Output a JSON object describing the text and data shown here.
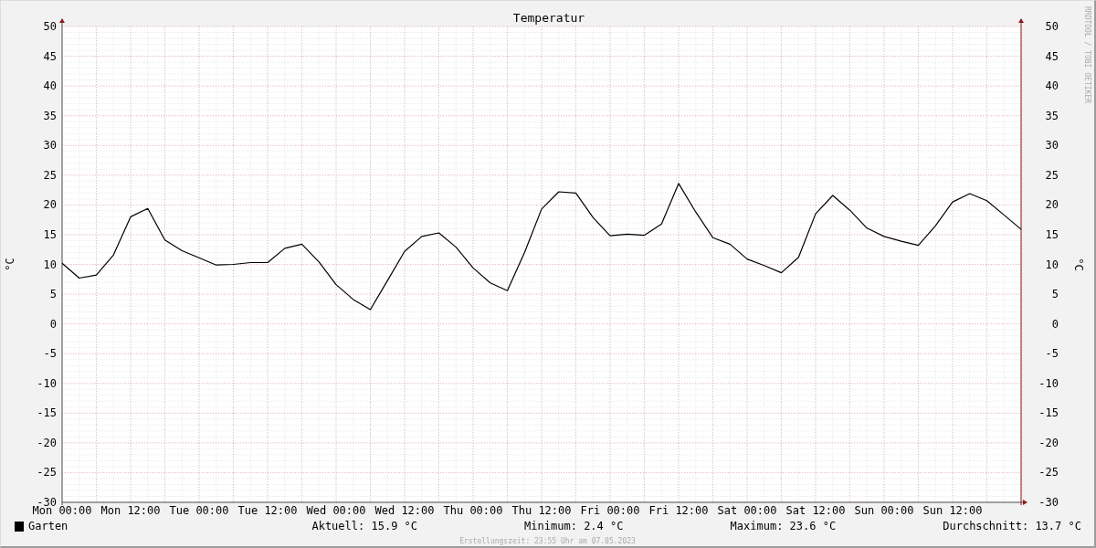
{
  "chart": {
    "credit": "RRDTOOL / TOBI OETIKER",
    "right_axis": {
      "label": "°C",
      "ticks": [
        "50",
        "45",
        "40",
        "35",
        "30",
        "25",
        "20",
        "15",
        "10",
        "5",
        "0",
        "-5",
        "-10",
        "-15",
        "-20",
        "-25",
        "-30"
      ]
    },
    "chart_data": {
      "type": "line",
      "title": "Temperatur",
      "ylabel": "°C",
      "categories": [
        "Mon 00:00",
        null,
        null,
        null,
        "Mon 12:00",
        null,
        null,
        null,
        "Tue 00:00",
        null,
        null,
        null,
        "Tue 12:00",
        null,
        null,
        null,
        "Wed 00:00",
        null,
        null,
        null,
        "Wed 12:00",
        null,
        null,
        null,
        "Thu 00:00",
        null,
        null,
        null,
        "Thu 12:00",
        null,
        null,
        null,
        "Fri 00:00",
        null,
        null,
        null,
        "Fri 12:00",
        null,
        null,
        null,
        "Sat 00:00",
        null,
        null,
        null,
        "Sat 12:00",
        null,
        null,
        null,
        "Sun 00:00",
        null,
        null,
        null,
        "Sun 12:00",
        null,
        null,
        null,
        null
      ],
      "series": [
        {
          "name": "Garten",
          "color": "#000000",
          "values": [
            10.2,
            7.7,
            8.2,
            11.6,
            18,
            19.4,
            14.1,
            12.3,
            11.1,
            9.9,
            10,
            10.3,
            10.3,
            12.7,
            13.4,
            10.4,
            6.6,
            4.1,
            2.4,
            7.3,
            12.2,
            14.7,
            15.3,
            12.9,
            9.4,
            6.9,
            5.6,
            12,
            19.3,
            22.2,
            22,
            17.9,
            14.8,
            15.1,
            14.9,
            16.8,
            23.6,
            18.8,
            14.5,
            13.4,
            10.9,
            9.8,
            8.6,
            11.2,
            18.5,
            21.6,
            19.1,
            16.1,
            14.7,
            13.9,
            13.2,
            16.5,
            20.5,
            21.9,
            20.7,
            18.3,
            15.9
          ]
        }
      ],
      "ylim": [
        -30,
        50
      ],
      "grid": true,
      "yticks": [
        50,
        45,
        40,
        35,
        30,
        25,
        20,
        15,
        10,
        5,
        0,
        -5,
        -10,
        -15,
        -20,
        -25,
        -30
      ]
    }
  },
  "legend": {
    "stats": [
      "Aktuell: 15.9 °C",
      "Minimum: 2.4 °C",
      "Maximum: 23.6 °C",
      "Durchschnitt: 13.7 °C"
    ]
  },
  "footer": "Erstellungszeit: 23:55 Uhr am 07.05.2023"
}
